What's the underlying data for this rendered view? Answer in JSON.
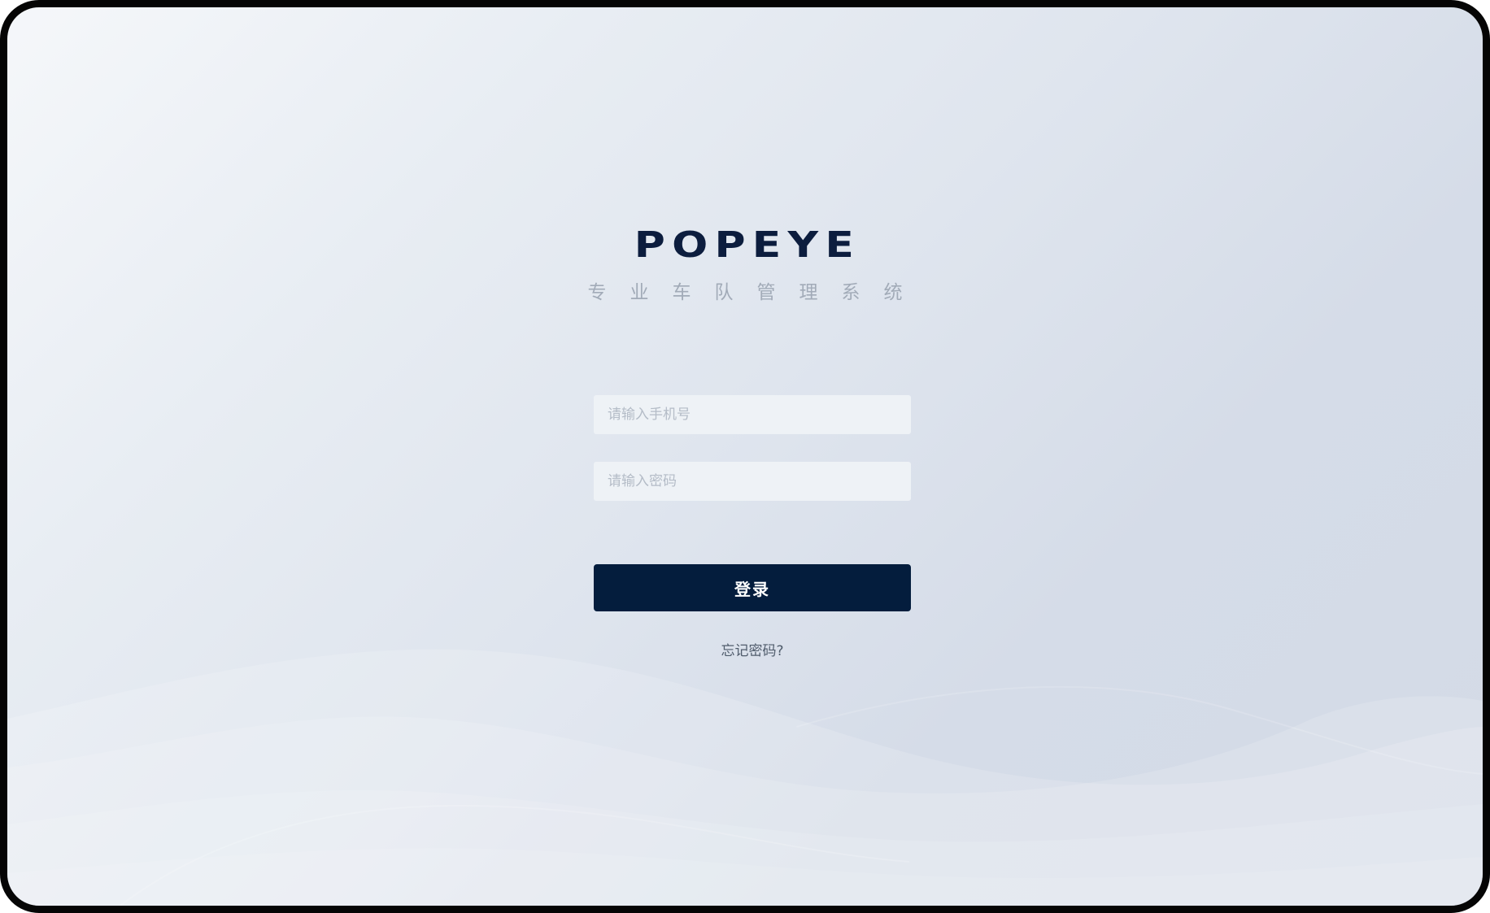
{
  "brand": {
    "logo": "POPEYE",
    "subtitle": "专业车队管理系统"
  },
  "login_form": {
    "phone_placeholder": "请输入手机号",
    "password_placeholder": "请输入密码",
    "submit_label": "登录",
    "forgot_password_label": "忘记密码?"
  },
  "colors": {
    "brand_navy": "#041d3d",
    "subtitle_gray": "#a2abb8",
    "input_background": "#eef2f6",
    "background_light": "#f5f7fa",
    "background_dark": "#d3dae6"
  }
}
